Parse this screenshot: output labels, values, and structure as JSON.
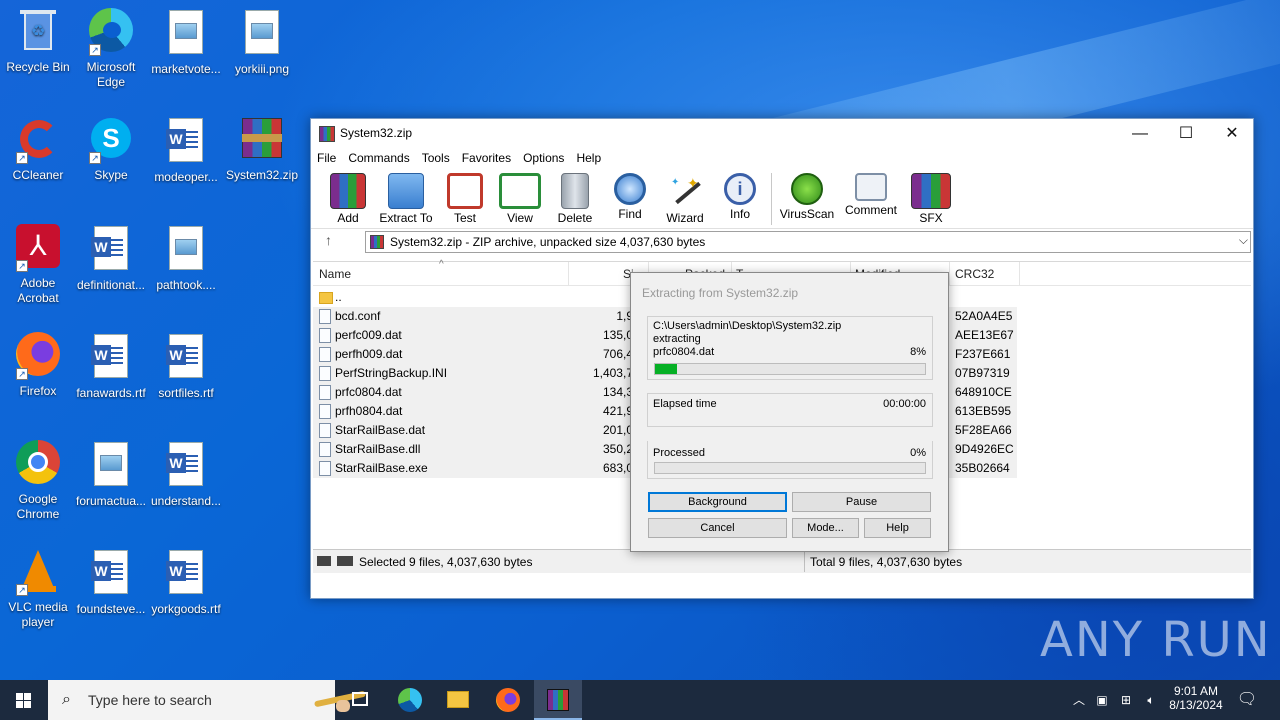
{
  "desktop": {
    "icons": [
      {
        "label": "Recycle Bin"
      },
      {
        "label": "Microsoft Edge"
      },
      {
        "label": "marketvote..."
      },
      {
        "label": "yorkiii.png"
      },
      {
        "label": "CCleaner"
      },
      {
        "label": "Skype"
      },
      {
        "label": "modeoper..."
      },
      {
        "label": "System32.zip"
      },
      {
        "label": "Adobe Acrobat"
      },
      {
        "label": "definitionat..."
      },
      {
        "label": "pathtook...."
      },
      {
        "label": "Firefox"
      },
      {
        "label": "fanawards.rtf"
      },
      {
        "label": "sortfiles.rtf"
      },
      {
        "label": "Google Chrome"
      },
      {
        "label": "forumactua..."
      },
      {
        "label": "understand..."
      },
      {
        "label": "VLC media player"
      },
      {
        "label": "foundsteve..."
      },
      {
        "label": "yorkgoods.rtf"
      }
    ]
  },
  "window": {
    "title": "System32.zip",
    "menu": [
      "File",
      "Commands",
      "Tools",
      "Favorites",
      "Options",
      "Help"
    ],
    "toolbar": [
      {
        "label": "Add",
        "icon": "add-archive-icon"
      },
      {
        "label": "Extract To",
        "icon": "extract-folder-icon"
      },
      {
        "label": "Test",
        "icon": "test-clipboard-icon"
      },
      {
        "label": "View",
        "icon": "view-book-icon"
      },
      {
        "label": "Delete",
        "icon": "trash-icon"
      },
      {
        "label": "Find",
        "icon": "magnifier-icon"
      },
      {
        "label": "Wizard",
        "icon": "wand-icon"
      },
      {
        "label": "Info",
        "icon": "info-icon"
      },
      {
        "label": "VirusScan",
        "icon": "virus-icon"
      },
      {
        "label": "Comment",
        "icon": "comment-icon"
      },
      {
        "label": "SFX",
        "icon": "sfx-box-icon"
      }
    ],
    "address": "System32.zip - ZIP archive, unpacked size 4,037,630 bytes",
    "columns": {
      "name": "Name",
      "size": "Si",
      "packed": "Packed",
      "type": "T",
      "modified": "Modified",
      "crc": "CRC32"
    },
    "files": [
      {
        "name": "..",
        "size": "",
        "crc": "",
        "kind": "folder"
      },
      {
        "name": "bcd.conf",
        "size": "1,9",
        "crc": "52A0A4E5",
        "kind": "file"
      },
      {
        "name": "perfc009.dat",
        "size": "135,0",
        "crc": "AEE13E67",
        "kind": "file"
      },
      {
        "name": "perfh009.dat",
        "size": "706,4",
        "crc": "F237E661",
        "kind": "file"
      },
      {
        "name": "PerfStringBackup.INI",
        "size": "1,403,7",
        "crc": "07B97319",
        "kind": "ini"
      },
      {
        "name": "prfc0804.dat",
        "size": "134,3",
        "crc": "648910CE",
        "kind": "file"
      },
      {
        "name": "prfh0804.dat",
        "size": "421,9",
        "crc": "613EB595",
        "kind": "file"
      },
      {
        "name": "StarRailBase.dat",
        "size": "201,0",
        "crc": "5F28EA66",
        "kind": "file"
      },
      {
        "name": "StarRailBase.dll",
        "size": "350,2",
        "crc": "9D4926EC",
        "kind": "dll"
      },
      {
        "name": "StarRailBase.exe",
        "size": "683,0",
        "crc": "35B02664",
        "kind": "exe"
      }
    ],
    "status_left": "Selected 9 files, 4,037,630 bytes",
    "status_right": "Total 9 files, 4,037,630 bytes"
  },
  "dialog": {
    "title": "Extracting from System32.zip",
    "archive_path": "C:\\Users\\admin\\Desktop\\System32.zip",
    "action": "extracting",
    "current_file": "prfc0804.dat",
    "file_percent": "8%",
    "file_progress": 0.08,
    "elapsed_label": "Elapsed time",
    "elapsed_value": "00:00:00",
    "processed_label": "Processed",
    "processed_percent": "0%",
    "processed_progress": 0.0,
    "buttons": {
      "background": "Background",
      "pause": "Pause",
      "cancel": "Cancel",
      "mode": "Mode...",
      "help": "Help"
    }
  },
  "taskbar": {
    "search_placeholder": "Type here to search",
    "time": "9:01 AM",
    "date": "8/13/2024"
  },
  "watermark": "ANY RUN",
  "colors": {
    "progress_fill": "#06b025",
    "taskbar": "#1c2a3e",
    "desktop": "#0a5fd0"
  }
}
